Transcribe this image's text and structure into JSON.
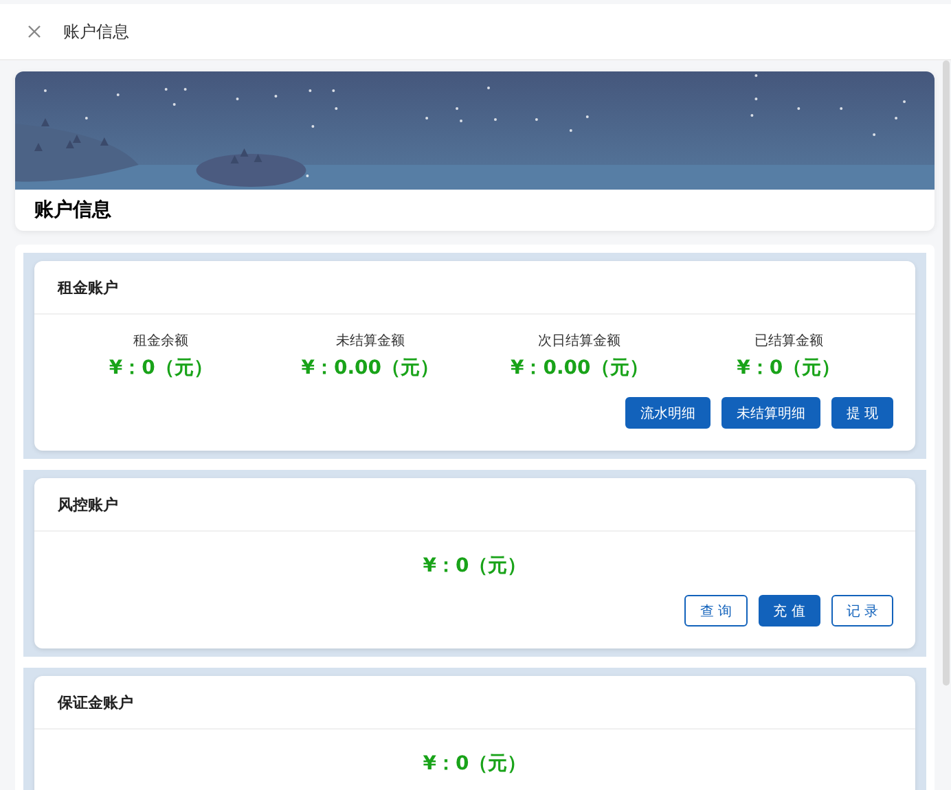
{
  "top_bar": {
    "title": "账户信息"
  },
  "banner": {
    "title": "账户信息"
  },
  "accounts": [
    {
      "title": "租金账户",
      "kind": "stats",
      "stats": [
        {
          "label": "租金余额",
          "amount": "¥：0（元）"
        },
        {
          "label": "未结算金额",
          "amount": "¥：0.00（元）"
        },
        {
          "label": "次日结算金额",
          "amount": "¥：0.00（元）"
        },
        {
          "label": "已结算金额",
          "amount": "¥：0（元）"
        }
      ],
      "buttons": [
        {
          "label": "流水明细",
          "kind": "primary"
        },
        {
          "label": "未结算明细",
          "kind": "primary"
        },
        {
          "label": "提 现",
          "kind": "primary"
        }
      ]
    },
    {
      "title": "风控账户",
      "kind": "single",
      "amount": "¥：0（元）",
      "buttons": [
        {
          "label": "查 询",
          "kind": "outline"
        },
        {
          "label": "充 值",
          "kind": "primary"
        },
        {
          "label": "记 录",
          "kind": "outline"
        }
      ]
    },
    {
      "title": "保证金账户",
      "kind": "single",
      "amount": "¥：0（元）"
    }
  ]
}
